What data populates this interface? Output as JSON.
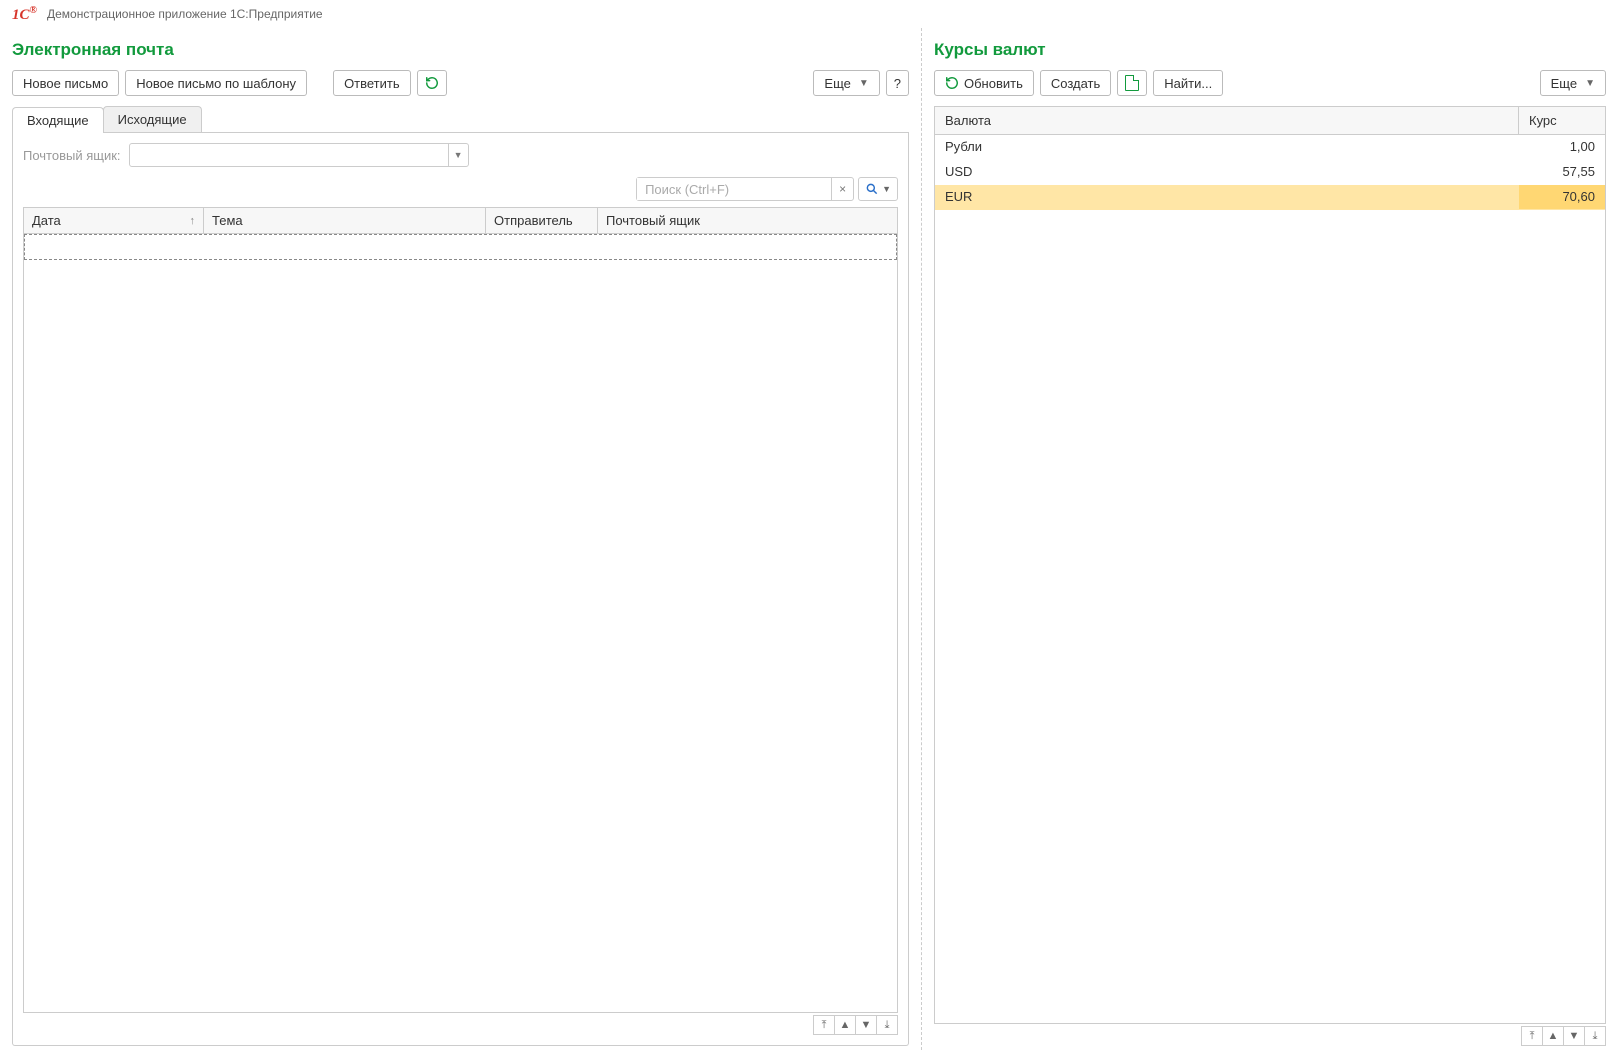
{
  "header": {
    "logo_text": "1C",
    "app_title": "Демонстрационное приложение 1С:Предприятие"
  },
  "email": {
    "title": "Электронная почта",
    "toolbar": {
      "new_mail": "Новое письмо",
      "new_mail_template": "Новое письмо по шаблону",
      "reply": "Ответить",
      "more": "Еще",
      "help": "?"
    },
    "tabs": {
      "inbox": "Входящие",
      "outbox": "Исходящие"
    },
    "mailbox_label": "Почтовый ящик:",
    "search_placeholder": "Поиск (Ctrl+F)",
    "columns": {
      "date": "Дата",
      "subject": "Тема",
      "sender": "Отправитель",
      "mailbox": "Почтовый ящик"
    }
  },
  "rates": {
    "title": "Курсы валют",
    "toolbar": {
      "refresh": "Обновить",
      "create": "Создать",
      "find": "Найти...",
      "more": "Еще"
    },
    "columns": {
      "currency": "Валюта",
      "rate": "Курс"
    },
    "rows": [
      {
        "currency": "Рубли",
        "rate": "1,00"
      },
      {
        "currency": "USD",
        "rate": "57,55"
      },
      {
        "currency": "EUR",
        "rate": "70,60"
      }
    ]
  }
}
